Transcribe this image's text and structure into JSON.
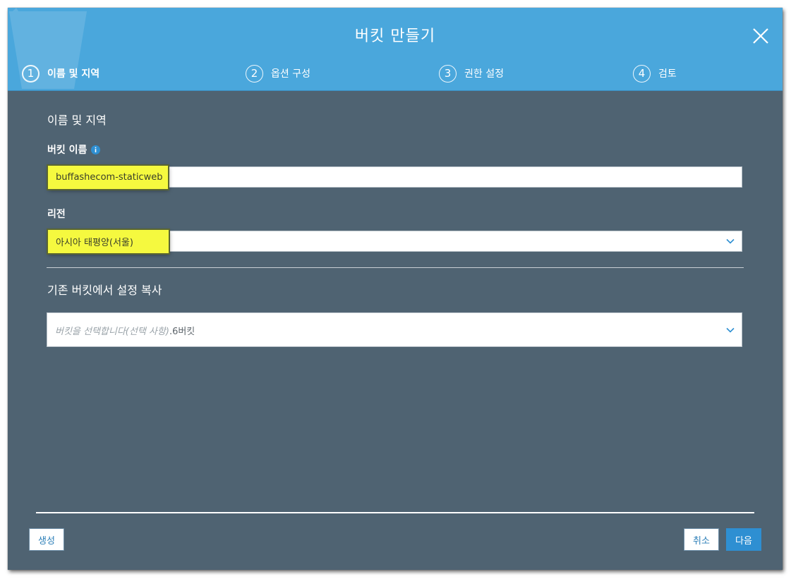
{
  "dialog": {
    "title": "버킷 만들기"
  },
  "steps": [
    {
      "number": "1",
      "label": "이름 및 지역",
      "active": true
    },
    {
      "number": "2",
      "label": "옵션 구성",
      "active": false
    },
    {
      "number": "3",
      "label": "권한 설정",
      "active": false
    },
    {
      "number": "4",
      "label": "검토",
      "active": false
    }
  ],
  "form": {
    "section_title": "이름 및 지역",
    "bucket_name_label": "버킷 이름",
    "bucket_name_value": "buffashecom-staticweb",
    "region_label": "리전",
    "region_value": "아시아 태평양(서울)",
    "copy_section_title": "기존 버킷에서 설정 복사",
    "copy_placeholder": "버킷을 선택합니다(선택 사항)",
    "copy_count": ".6버킷"
  },
  "footer": {
    "create_label": "생성",
    "cancel_label": "취소",
    "next_label": "다음"
  },
  "colors": {
    "header_bg": "#4aa7dc",
    "body_bg": "#4f6372",
    "highlight": "#f5f93f",
    "primary_button": "#2e8fd2"
  },
  "icons": {
    "close": "close-icon",
    "info": "info-icon",
    "dropdown": "chevron-down-icon"
  }
}
